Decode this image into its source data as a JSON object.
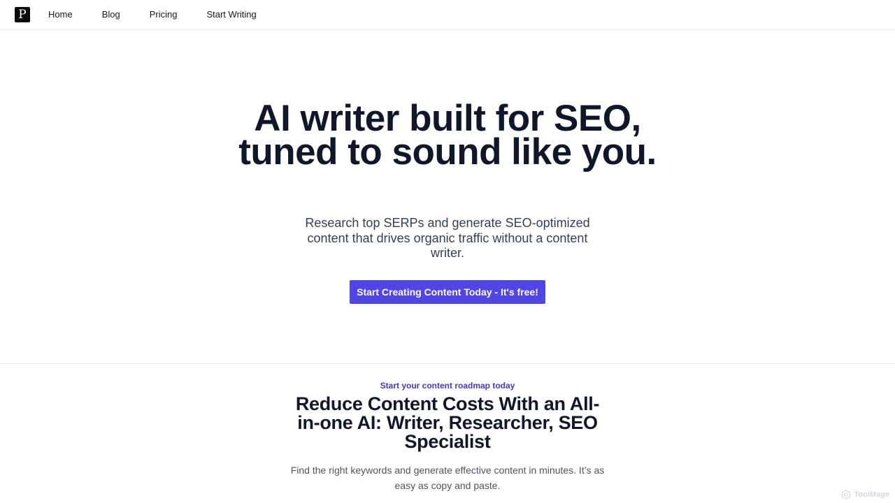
{
  "nav": {
    "logo_letter": "P",
    "links": [
      "Home",
      "Blog",
      "Pricing",
      "Start Writing"
    ]
  },
  "hero": {
    "title": "AI writer built for SEO, tuned to sound like you.",
    "subtitle": "Research top SERPs and generate SEO-optimized content that drives organic traffic without a content writer.",
    "cta_label": "Start Creating Content Today - It's free!"
  },
  "features": {
    "eyebrow": "Start your content roadmap today",
    "title": "Reduce Content Costs With an All-in-one AI: Writer, Researcher, SEO Specialist",
    "description": "Find the right keywords and generate effective content in minutes. It’s as easy as copy and paste."
  },
  "watermark": {
    "text": "ToolMage"
  },
  "colors": {
    "accent": "#4f46e5",
    "eyebrow": "#4338ca",
    "heading": "#0f172a",
    "divider": "#e5e7eb"
  }
}
